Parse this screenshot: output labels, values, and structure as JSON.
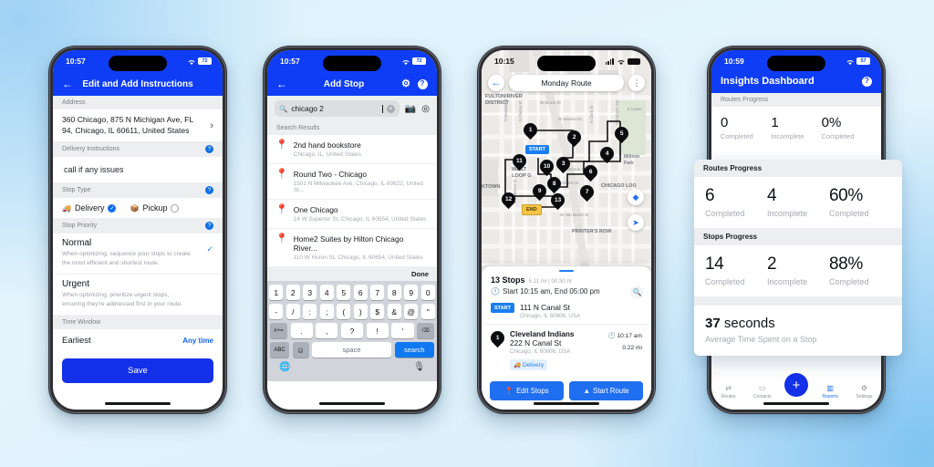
{
  "background": {
    "accent": "#0f3df5",
    "page_bg_from": "#ddf2fb",
    "page_bg_to": "#7fc4f2"
  },
  "phone1": {
    "status": {
      "time": "10:57",
      "battery": "72",
      "wifi_icon": "wifi-icon"
    },
    "nav": {
      "back_icon": "back-arrow-icon",
      "title": "Edit and Add Instructions"
    },
    "sections": {
      "address_label": "Address",
      "address_value": "360 Chicago, 875 N Michigan Ave, FL 94, Chicago, IL 60611, United States",
      "chevron_icon": "chevron-right-icon",
      "delivery_instructions_label": "Delivery Instructions",
      "delivery_instructions_value": "call if any issues",
      "stop_type_label": "Stop Type",
      "stop_type_options": [
        {
          "label": "Delivery",
          "selected": true,
          "icon": "truck-icon"
        },
        {
          "label": "Pickup",
          "selected": false,
          "icon": "package-icon"
        }
      ],
      "stop_priority_label": "Stop Priority",
      "priorities": [
        {
          "title": "Normal",
          "desc": "When optimizing, sequence your stops to create the most efficient and shortest route.",
          "selected": true
        },
        {
          "title": "Urgent",
          "desc": "When optimizing, prioritize urgent stops, ensuring they're addressed first in your route.",
          "selected": false
        }
      ],
      "time_window_label": "Time Window",
      "earliest_label": "Earliest",
      "earliest_value": "Any time",
      "save_label": "Save",
      "help_icon": "question-mark-icon"
    }
  },
  "phone2": {
    "status": {
      "time": "10:57",
      "battery": "72"
    },
    "nav": {
      "back_icon": "back-arrow-icon",
      "title": "Add Stop",
      "gear_icon": "gear-icon",
      "help_icon": "question-mark-icon"
    },
    "search": {
      "value": "chicago 2",
      "placeholder": "Search",
      "search_icon": "search-icon",
      "clear_icon": "clear-icon",
      "camera_icon": "camera-icon",
      "locate_icon": "locate-icon"
    },
    "results_label": "Search Results",
    "results": [
      {
        "title": "2nd hand bookstore",
        "subtitle": "Chicago, IL, United States"
      },
      {
        "title": "Round Two - Chicago",
        "subtitle": "1501 N Milwaukee Ave, Chicago, IL 60622, United St..."
      },
      {
        "title": "One Chicago",
        "subtitle": "14 W Superior St, Chicago, IL  60654, United States"
      },
      {
        "title": "Home2 Suites by Hilton Chicago River...",
        "subtitle": "110 W Huron St, Chicago, IL  60654, United States"
      }
    ],
    "done_label": "Done",
    "keyboard": {
      "row1": [
        "1",
        "2",
        "3",
        "4",
        "5",
        "6",
        "7",
        "8",
        "9",
        "0"
      ],
      "row2": [
        "-",
        "/",
        ":",
        ";",
        "(",
        ")",
        "$",
        "&",
        "@",
        "\""
      ],
      "row3_left": "#+=",
      "row3": [
        ".",
        ",",
        "?",
        "!",
        "'"
      ],
      "row3_right": "delete-icon",
      "row4_abc": "ABC",
      "row4_emoji": "emoji-icon",
      "row4_space": "space",
      "row4_search": "search",
      "globe_icon": "globe-icon",
      "mic_icon": "microphone-icon"
    }
  },
  "phone3": {
    "status": {
      "time": "10:15",
      "signal_icon": "cellular-icon",
      "wifi_icon": "wifi-icon",
      "battery_icon": "battery-icon"
    },
    "map": {
      "back_icon": "back-arrow-icon",
      "route_title": "Monday Route",
      "menu_icon": "more-vertical-icon",
      "layers_icon": "map-layers-icon",
      "navigate_icon": "navigate-icon",
      "start_chip": "START",
      "end_chip": "END",
      "stop_numbers": [
        "1",
        "2",
        "3",
        "4",
        "5",
        "6",
        "7",
        "8",
        "9",
        "10",
        "11",
        "12",
        "13"
      ],
      "labels": [
        "FULTON RIVER DISTRICT",
        "W Kinzie St",
        "W Wacker Dr",
        "N Desplaines St",
        "N Clinton St",
        "N Clark St",
        "N Wells St",
        "N Wabash Ave",
        "WEST LOOP GATE",
        "CHICAGO LOOP",
        "W Monroe St",
        "W Adams St",
        "W Van Buren St",
        "PRINTER'S ROW",
        "S Jefferson St",
        "Millennium Park",
        "KTOWN"
      ]
    },
    "sheet": {
      "stops_count": "13 Stops",
      "distance_duration": "5.11 mi | 00:30 hr",
      "schedule": "Start 10:15 am, End 05:00 pm",
      "clock_icon": "clock-icon",
      "search_icon": "search-icon",
      "items": [
        {
          "badge": "START",
          "title": "",
          "address": "111 N Canal St",
          "sub": "Chicago, IL 60606, USA",
          "time": "",
          "dist": "",
          "tag": ""
        },
        {
          "badge": "1",
          "title": "Cleveland Indians",
          "address": "222 N Canal St",
          "sub": "Chicago, IL 60606, USA",
          "time": "10:17 am",
          "dist": "0.22 mi",
          "tag": "Delivery"
        }
      ],
      "edit_stops_label": "Edit Stops",
      "edit_stops_icon": "pin-icon",
      "start_route_label": "Start Route",
      "start_route_icon": "navigate-icon"
    }
  },
  "phone4": {
    "status": {
      "time": "10:59",
      "battery": "57"
    },
    "nav": {
      "title": "Insights Dashboard",
      "help_icon": "question-mark-icon"
    },
    "routes_progress_label": "Routes Progress",
    "routes_progress": [
      {
        "value": "0",
        "label": "Completed"
      },
      {
        "value": "1",
        "label": "Incomplete"
      },
      {
        "value": "0%",
        "label": "Completed"
      }
    ],
    "tabbar": [
      {
        "label": "Routes",
        "icon": "routes-icon",
        "active": false
      },
      {
        "label": "Contacts",
        "icon": "contacts-icon",
        "active": false
      },
      {
        "label": "Reports",
        "icon": "reports-icon",
        "active": true
      },
      {
        "label": "Settings",
        "icon": "settings-icon",
        "active": false
      }
    ],
    "fab_icon": "plus-icon"
  },
  "overlay": {
    "routes_progress_label": "Routes Progress",
    "routes_progress": [
      {
        "value": "6",
        "label": "Completed"
      },
      {
        "value": "4",
        "label": "Incomplete"
      },
      {
        "value": "60%",
        "label": "Completed"
      }
    ],
    "stops_progress_label": "Stops Progress",
    "stops_progress": [
      {
        "value": "14",
        "label": "Completed"
      },
      {
        "value": "2",
        "label": "Incomplete"
      },
      {
        "value": "88%",
        "label": "Completed"
      }
    ],
    "average": {
      "value": "37",
      "unit": "seconds",
      "label": "Average Time Spent on a Stop"
    }
  }
}
